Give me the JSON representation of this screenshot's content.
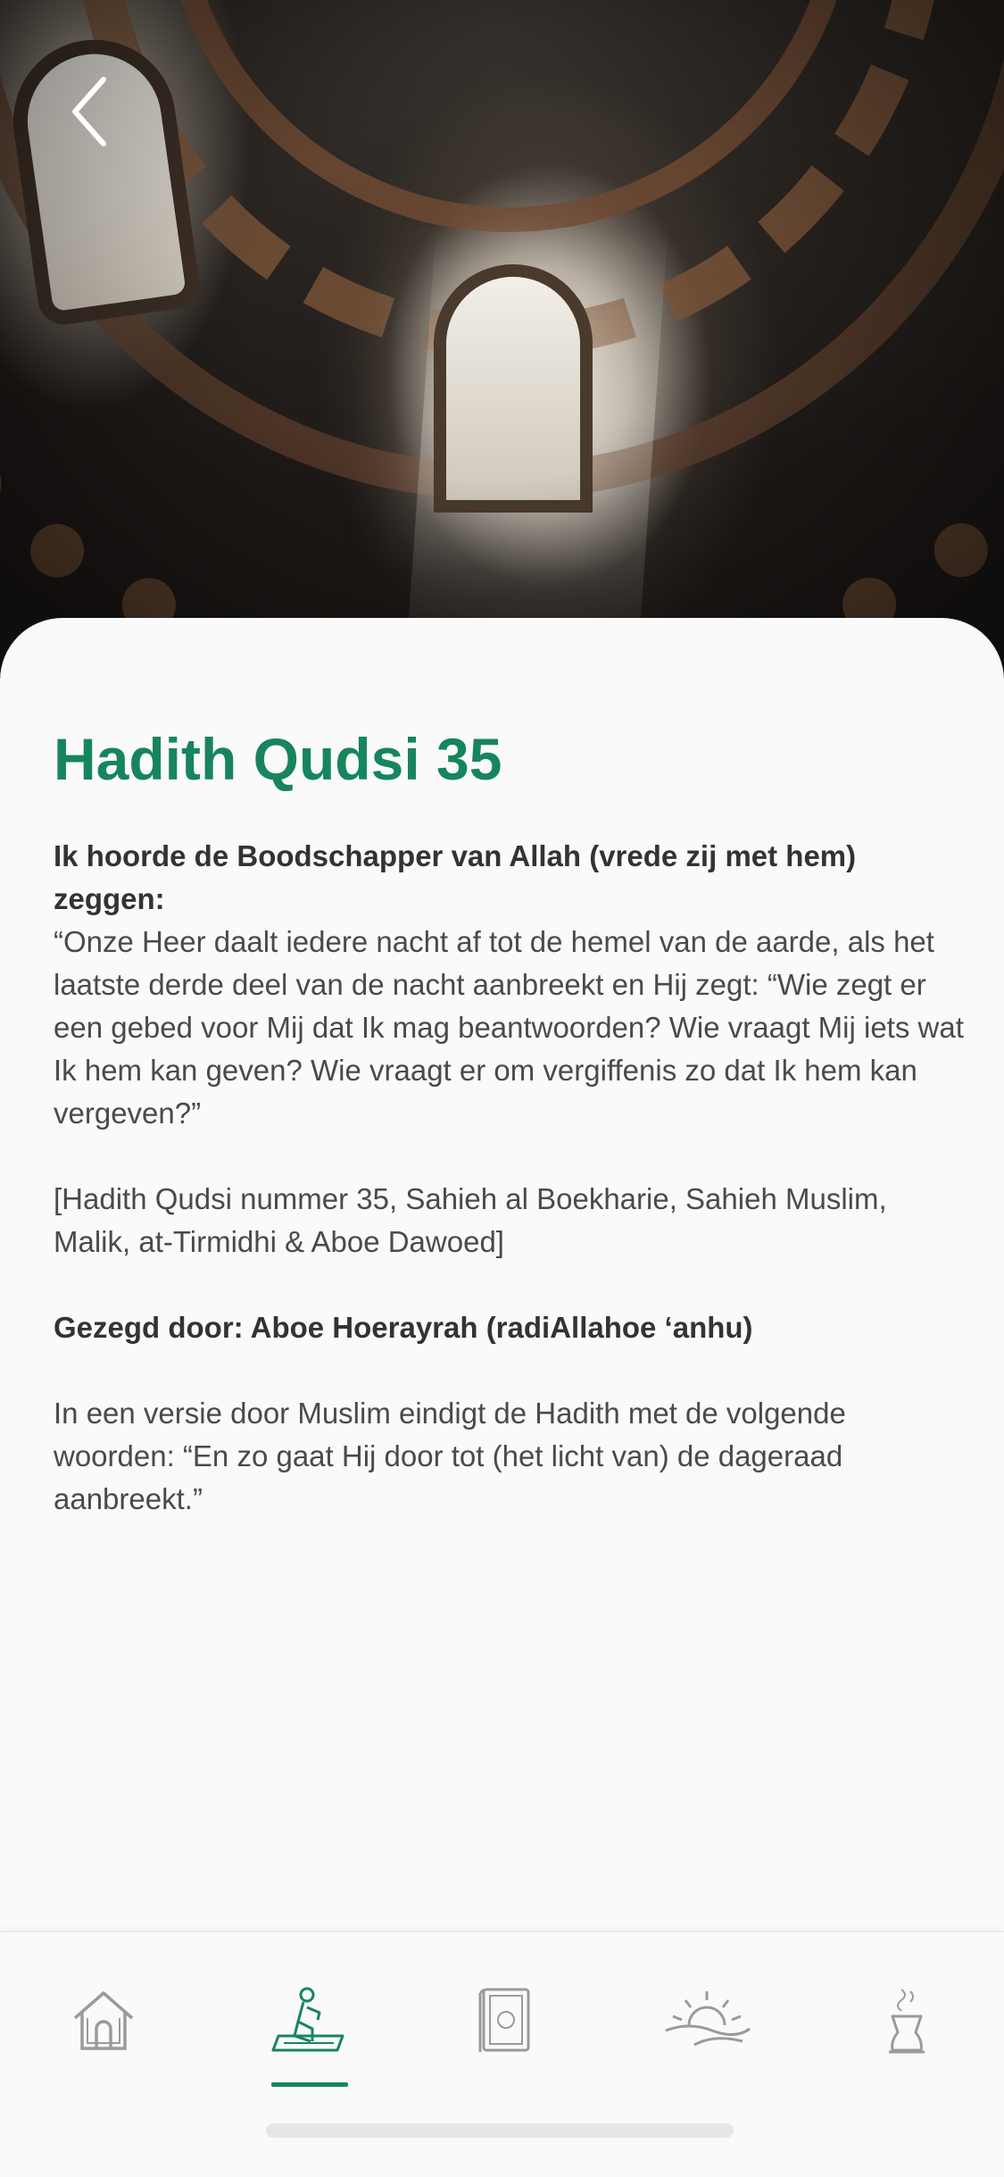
{
  "header": {
    "back_icon": "chevron-left-icon",
    "hero_image": "mosque-dome-interior"
  },
  "hadith": {
    "title": "Hadith Qudsi 35",
    "intro": "Ik hoorde de Boodschapper van Allah (vrede zij met hem) zeggen:",
    "quote": "“Onze Heer daalt iedere nacht af tot de hemel van de aarde, als het laatste derde deel van de nacht aanbreekt en Hij zegt: “Wie zegt er een gebed voor Mij dat Ik mag beantwoorden? Wie vraagt Mij iets wat Ik hem kan geven? Wie vraagt er om vergiffenis zo dat Ik hem kan vergeven?”",
    "source": "[Hadith Qudsi nummer 35, Sahieh al Boekharie, Sahieh Muslim, Malik, at-Tirmidhi & Aboe Dawoed]",
    "narrator": "Gezegd door: Aboe Hoerayrah (radiAllahoe ‘anhu)",
    "note": "In een versie door Muslim eindigt de Hadith met de volgende woorden: “En zo gaat Hij door tot (het licht van) de dageraad aanbreekt.”"
  },
  "nav": {
    "items": [
      {
        "icon": "home-icon",
        "active": false
      },
      {
        "icon": "prayer-icon",
        "active": true
      },
      {
        "icon": "quran-book-icon",
        "active": false
      },
      {
        "icon": "sunrise-icon",
        "active": false
      },
      {
        "icon": "lamp-icon",
        "active": false
      }
    ]
  },
  "colors": {
    "accent": "#17855c",
    "text": "#4a4a4a",
    "icon_inactive": "#9a9a9a"
  }
}
